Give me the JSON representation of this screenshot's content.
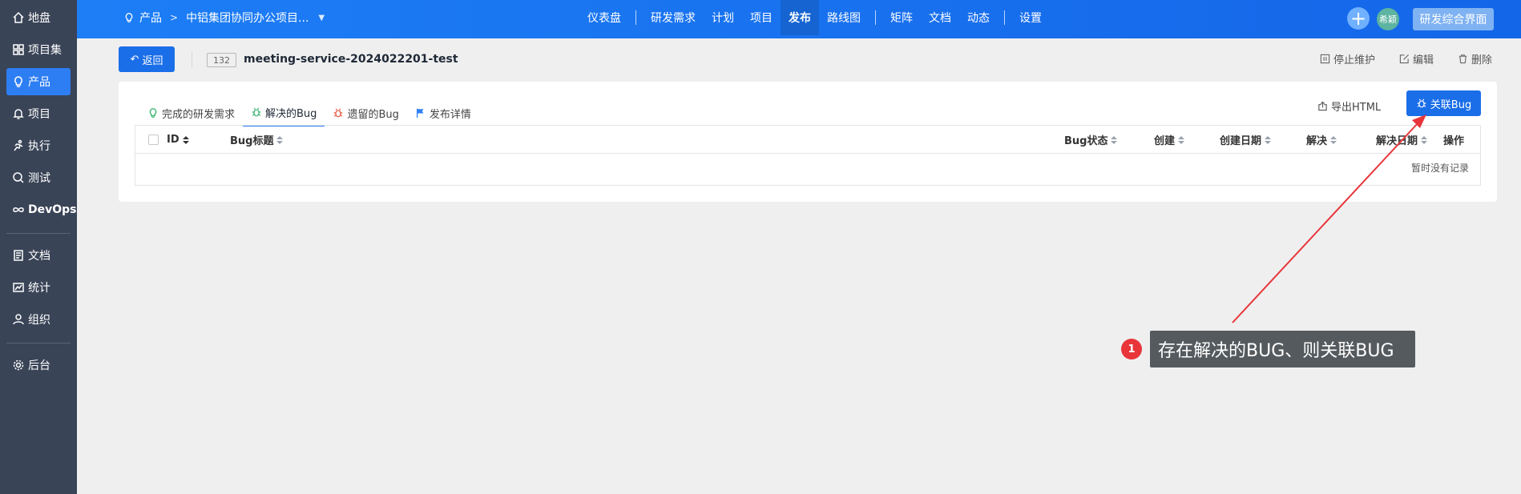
{
  "sidebar": {
    "items": [
      {
        "label": "地盘",
        "icon": "home-icon"
      },
      {
        "label": "项目集",
        "icon": "grid-icon"
      },
      {
        "label": "产品",
        "icon": "lightbulb-icon"
      },
      {
        "label": "项目",
        "icon": "bell-icon"
      },
      {
        "label": "执行",
        "icon": "run-icon"
      },
      {
        "label": "测试",
        "icon": "search-test-icon"
      },
      {
        "label": "DevOps",
        "icon": "infinity-icon"
      },
      {
        "label": "文档",
        "icon": "doc-icon"
      },
      {
        "label": "统计",
        "icon": "chart-icon"
      },
      {
        "label": "组织",
        "icon": "user-icon"
      },
      {
        "label": "后台",
        "icon": "gear-icon"
      }
    ],
    "active_index": 2
  },
  "topbar": {
    "breadcrumb_root": "产品",
    "breadcrumb_product": "中铝集团协同办公项目...",
    "nav": [
      "仪表盘",
      "研发需求",
      "计划",
      "项目",
      "发布",
      "路线图",
      "矩阵",
      "文档",
      "动态",
      "设置"
    ],
    "active_nav": "发布",
    "plus": "+",
    "avatar": "希颖",
    "switch_button": "研发综合界面"
  },
  "header": {
    "back_label": "返回",
    "release_id": "132",
    "release_title": "meeting-service-2024022201-test",
    "actions": {
      "stop": "停止维护",
      "edit": "编辑",
      "delete": "删除"
    }
  },
  "panel": {
    "tabs": [
      {
        "label": "完成的研发需求",
        "icon": "lightbulb-icon",
        "color": "#32b36b"
      },
      {
        "label": "解决的Bug",
        "icon": "bug-icon",
        "color": "#32b36b"
      },
      {
        "label": "遗留的Bug",
        "icon": "bug-icon",
        "color": "#e8553a"
      },
      {
        "label": "发布详情",
        "icon": "flag-icon",
        "color": "#2e7ef3"
      }
    ],
    "active_tab": "解决的Bug",
    "export_label": "导出HTML",
    "link_bug_label": "关联Bug",
    "columns": [
      "ID",
      "Bug标题",
      "Bug状态",
      "创建",
      "创建日期",
      "解决",
      "解决日期",
      "操作"
    ],
    "empty_text": "暂时没有记录"
  },
  "annotation": {
    "number": "1",
    "text": "存在解决的BUG、则关联BUG",
    "color": "#e8353a"
  }
}
